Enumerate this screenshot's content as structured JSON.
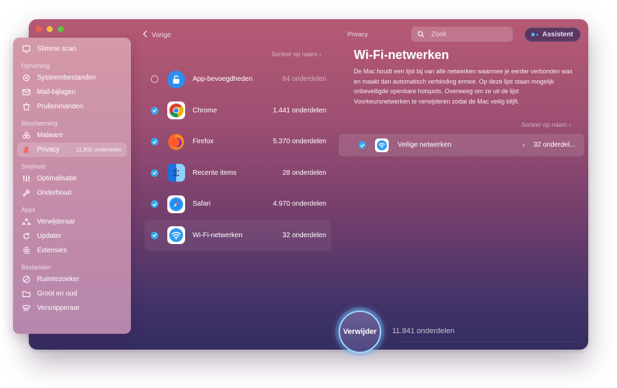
{
  "window": {
    "controls": [
      "close",
      "minimize",
      "zoom"
    ]
  },
  "sidebar": {
    "items": [
      {
        "type": "item",
        "label": "Slimme scan",
        "icon": "monitor-icon"
      },
      {
        "type": "section",
        "label": "Opruiming"
      },
      {
        "type": "item",
        "label": "Systeembestanden",
        "icon": "gear-icon"
      },
      {
        "type": "item",
        "label": "Mail-bijlagen",
        "icon": "envelope-icon"
      },
      {
        "type": "item",
        "label": "Prullenmanden",
        "icon": "trash-icon"
      },
      {
        "type": "section",
        "label": "Bescherming"
      },
      {
        "type": "item",
        "label": "Malware",
        "icon": "biohazard-icon"
      },
      {
        "type": "item",
        "label": "Privacy",
        "icon": "hand-icon",
        "active": true,
        "count": "11.905 onderdelen"
      },
      {
        "type": "section",
        "label": "Snelheid"
      },
      {
        "type": "item",
        "label": "Optimalisatie",
        "icon": "sliders-icon"
      },
      {
        "type": "item",
        "label": "Onderhoud",
        "icon": "wrench-icon"
      },
      {
        "type": "section",
        "label": "Apps"
      },
      {
        "type": "item",
        "label": "Verwijderaar",
        "icon": "apps-icon"
      },
      {
        "type": "item",
        "label": "Updater",
        "icon": "update-icon"
      },
      {
        "type": "item",
        "label": "Extensies",
        "icon": "extension-icon"
      },
      {
        "type": "section",
        "label": "Bestanden"
      },
      {
        "type": "item",
        "label": "Ruimtezoeker",
        "icon": "disk-icon"
      },
      {
        "type": "item",
        "label": "Groot en oud",
        "icon": "folder-icon"
      },
      {
        "type": "item",
        "label": "Versnipperaar",
        "icon": "shredder-icon"
      }
    ]
  },
  "nav": {
    "back_label": "Vorige"
  },
  "list": {
    "sort_label": "Sorteer op naam",
    "rows": [
      {
        "name": "App-bevoegdheden",
        "count": "64 onderdelen",
        "checked": false,
        "icon": "lock-icon",
        "dim": true
      },
      {
        "name": "Chrome",
        "count": "1.441 onderdelen",
        "checked": true,
        "icon": "chrome-icon"
      },
      {
        "name": "Firefox",
        "count": "5.370 onderdelen",
        "checked": true,
        "icon": "firefox-icon"
      },
      {
        "name": "Recente items",
        "count": "28 onderdelen",
        "checked": true,
        "icon": "finder-icon"
      },
      {
        "name": "Safari",
        "count": "4.970 onderdelen",
        "checked": true,
        "icon": "safari-icon"
      },
      {
        "name": "Wi-Fi-netwerken",
        "count": "32 onderdelen",
        "checked": true,
        "icon": "wifi-icon",
        "selected": true
      }
    ]
  },
  "header": {
    "section_label": "Privacy",
    "search_placeholder": "Zoek",
    "assistant_label": "Assistent"
  },
  "detail": {
    "title": "Wi-Fi-netwerken",
    "description": "De Mac houdt een lijst bij van alle netwerken waarmee je eerder verbonden was en maakt dan automatisch verbinding ermee. Op deze lijst staan mogelijk onbeveiligde openbare hotspots. Overweeg om ze uit de lijst Voorkeursnetwerken te verwijderen zodat de Mac veilig blijft.",
    "sort_label": "Sorteer op naam",
    "item": {
      "name": "Veilige netwerken",
      "count": "32 onderdel..."
    }
  },
  "footer": {
    "remove_label": "Verwijder",
    "total": "11.841 onderdelen"
  },
  "colors": {
    "accent": "#35a9ea",
    "check": "#35a9ea"
  }
}
